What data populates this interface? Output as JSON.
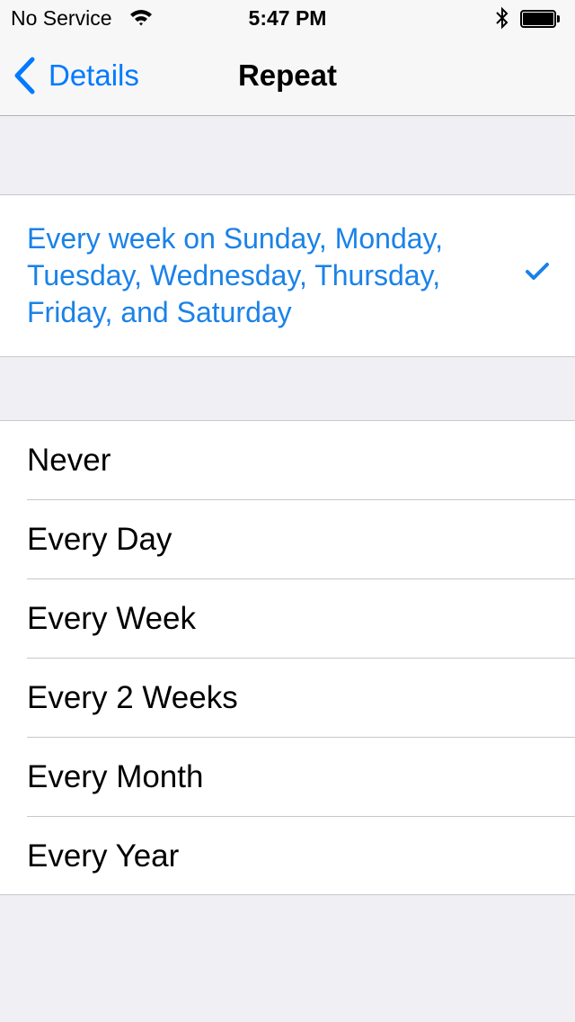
{
  "status_bar": {
    "carrier": "No Service",
    "time": "5:47 PM",
    "icons": [
      "wifi-icon",
      "bluetooth-icon",
      "battery-icon"
    ]
  },
  "nav": {
    "back_label": "Details",
    "title": "Repeat"
  },
  "selected": {
    "label": "Every week on Sunday, Monday, Tuesday, Wednesday, Thursday, Friday, and Saturday",
    "accent": "#1a82e8",
    "icon": "checkmark-icon"
  },
  "options": [
    {
      "label": "Never"
    },
    {
      "label": "Every Day"
    },
    {
      "label": "Every Week"
    },
    {
      "label": "Every 2 Weeks"
    },
    {
      "label": "Every Month"
    },
    {
      "label": "Every Year"
    }
  ],
  "colors": {
    "tint": "#007aff",
    "background": "#efeff4",
    "separator": "#c8c7cc"
  }
}
